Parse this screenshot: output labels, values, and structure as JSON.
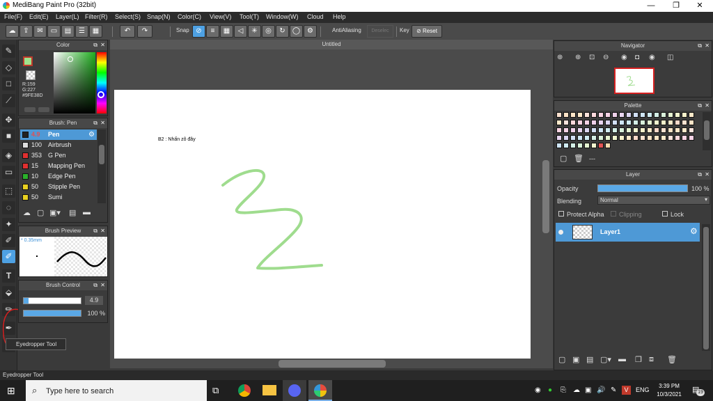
{
  "titlebar": {
    "title": "MediBang Paint Pro (32bit)",
    "min": "—",
    "max": "❐",
    "close": "✕"
  },
  "menu": [
    "File(F)",
    "Edit(E)",
    "Layer(L)",
    "Filter(R)",
    "Select(S)",
    "Snap(N)",
    "Color(C)",
    "View(V)",
    "Tool(T)",
    "Window(W)",
    "Cloud",
    "Help"
  ],
  "toolbar": {
    "snap_label": "Snap",
    "antialias_label": "AntiAliasing",
    "deselect_label": "Deselec",
    "key_label": "Key",
    "reset_label": "Reset"
  },
  "color_panel": {
    "title": "Color",
    "r": "R:159",
    "g": "G:227",
    "hex": "#9FE38D",
    "fg_color": "#9fe38d"
  },
  "brush_panel": {
    "title": "Brush: Pen",
    "items": [
      {
        "size": "4.9",
        "name": "Pen",
        "color": "#222222"
      },
      {
        "size": "100",
        "name": "Airbrush",
        "color": "#dddddd"
      },
      {
        "size": "353",
        "name": "G Pen",
        "color": "#e03030"
      },
      {
        "size": "15",
        "name": "Mapping Pen",
        "color": "#e03030"
      },
      {
        "size": "10",
        "name": "Edge Pen",
        "color": "#2bb02b"
      },
      {
        "size": "50",
        "name": "Stipple Pen",
        "color": "#e8d020"
      },
      {
        "size": "50",
        "name": "Sumi",
        "color": "#e8d020"
      }
    ]
  },
  "brush_preview": {
    "title": "Brush Preview",
    "size": "* 0.35mm"
  },
  "brush_control": {
    "title": "Brush Control",
    "size_value": "4.9",
    "size_fraction": 0.08,
    "opacity_value": "100 %",
    "opacity_fraction": 1.0
  },
  "tooltip": "Eyedropper Tool",
  "canvas": {
    "doc_title": "Untitled",
    "note": "B2 : Nhấn zô đây",
    "stroke_color": "#9fdc8e"
  },
  "navigator": {
    "title": "Navigator"
  },
  "palette": {
    "title": "Palette",
    "dash": "---"
  },
  "layer_panel": {
    "title": "Layer",
    "opacity_label": "Opacity",
    "opacity_value": "100 %",
    "opacity_fraction": 1.0,
    "blending_label": "Blending",
    "blending_value": "Normal",
    "protect_alpha": "Protect Alpha",
    "clipping": "Clipping",
    "lock": "Lock",
    "layer_name": "Layer1"
  },
  "statusbar": {
    "text": "Eyedropper Tool"
  },
  "taskbar": {
    "search_placeholder": "Type here to search",
    "lang": "ENG",
    "time": "3:39 PM",
    "date": "10/3/2021",
    "notif_count": "19"
  }
}
